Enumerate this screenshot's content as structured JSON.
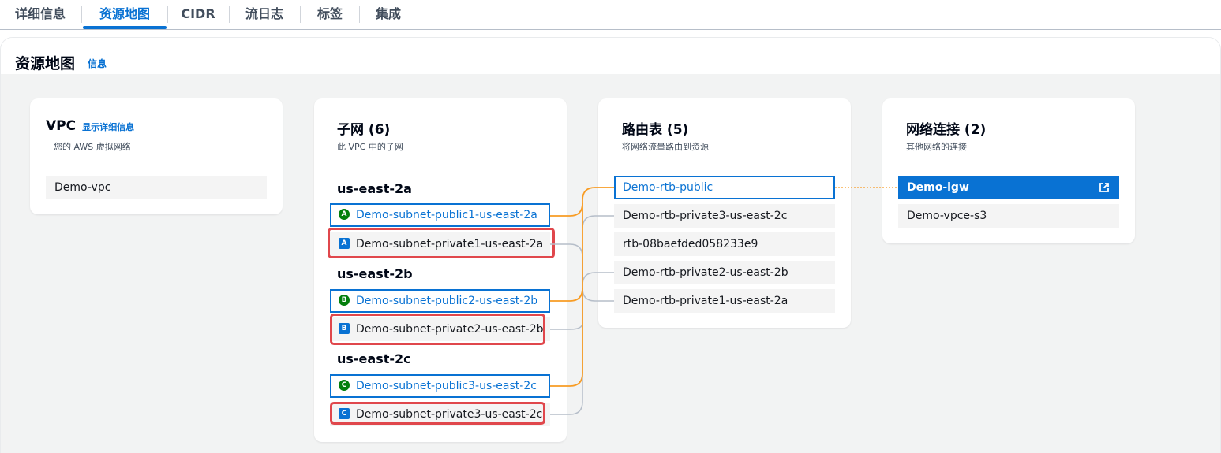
{
  "tabs": [
    {
      "label": "详细信息"
    },
    {
      "label": "资源地图"
    },
    {
      "label": "CIDR"
    },
    {
      "label": "流日志"
    },
    {
      "label": "标签"
    },
    {
      "label": "集成"
    }
  ],
  "section": {
    "title": "资源地图",
    "info_link": "信息"
  },
  "vpc_card": {
    "title": "VPC",
    "link": "显示详细信息",
    "subtitle": "您的 AWS 虚拟网络",
    "item": "Demo-vpc"
  },
  "subnets_card": {
    "title": "子网 (6)",
    "subtitle": "此 VPC 中的子网",
    "zones": [
      {
        "name": "us-east-2a",
        "public": {
          "badge": "A",
          "label": "Demo-subnet-public1-us-east-2a"
        },
        "private": {
          "badge": "A",
          "label": "Demo-subnet-private1-us-east-2a"
        }
      },
      {
        "name": "us-east-2b",
        "public": {
          "badge": "B",
          "label": "Demo-subnet-public2-us-east-2b"
        },
        "private": {
          "badge": "B",
          "label": "Demo-subnet-private2-us-east-2b"
        }
      },
      {
        "name": "us-east-2c",
        "public": {
          "badge": "C",
          "label": "Demo-subnet-public3-us-east-2c"
        },
        "private": {
          "badge": "C",
          "label": "Demo-subnet-private3-us-east-2c"
        }
      }
    ]
  },
  "route_tables_card": {
    "title": "路由表 (5)",
    "subtitle": "将网络流量路由到资源",
    "items": [
      "Demo-rtb-public",
      "Demo-rtb-private3-us-east-2c",
      "rtb-08baefded058233e9",
      "Demo-rtb-private2-us-east-2b",
      "Demo-rtb-private1-us-east-2a"
    ]
  },
  "network_card": {
    "title": "网络连接 (2)",
    "subtitle": "其他网络的连接",
    "items": [
      "Demo-igw",
      "Demo-vpce-s3"
    ]
  },
  "colors": {
    "accent": "#0972d3",
    "public_line": "#f89c24",
    "private_line": "#b6bec9",
    "highlight": "#e0474c",
    "public_badge": "#037f0c"
  },
  "icons": {
    "external_link": "external-link-icon"
  }
}
